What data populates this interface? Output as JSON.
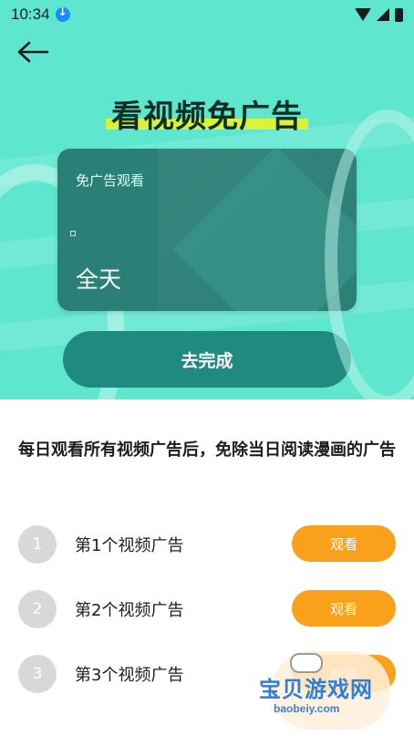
{
  "status": {
    "time": "10:34"
  },
  "hero": {
    "title": "看视频免广告",
    "card": {
      "label": "免广告观看",
      "value": "全天"
    },
    "cta": "去完成"
  },
  "description": "每日观看所有视频广告后，免除当日阅读漫画的广告",
  "tasks": [
    {
      "index": "1",
      "label": "第1个视频广告",
      "button": "观看"
    },
    {
      "index": "2",
      "label": "第2个视频广告",
      "button": "观看"
    },
    {
      "index": "3",
      "label": "第3个视频广告",
      "button": "观看"
    }
  ],
  "watermark": {
    "title": "宝贝游戏网",
    "url": "baobeiy.com"
  },
  "colors": {
    "hero_bg": "#5ee6cf",
    "card": "#2a7f76",
    "cta": "#1f8b80",
    "watch": "#f9a11b",
    "num_badge": "#d8d8d8"
  },
  "icons": [
    "download-icon",
    "wifi-icon",
    "signal-icon",
    "battery-icon",
    "back-arrow-icon"
  ]
}
